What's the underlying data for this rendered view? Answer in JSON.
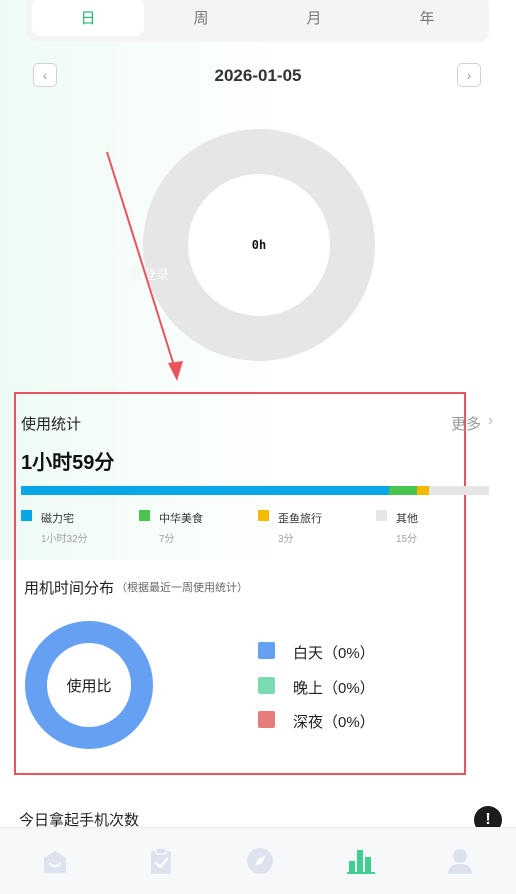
{
  "period_tabs": [
    {
      "label": "日",
      "active": true
    },
    {
      "label": "周",
      "active": false
    },
    {
      "label": "月",
      "active": false
    },
    {
      "label": "年",
      "active": false
    }
  ],
  "date_nav": {
    "date": "2026-01-05",
    "prev_icon": "chevron-left-icon",
    "next_icon": "chevron-right-icon"
  },
  "overview_ring": {
    "center_text": "0h",
    "overlay_text": "未登录",
    "ring_color": "#e6e6e6"
  },
  "usage_stats": {
    "title": "使用统计",
    "more_label": "更多",
    "total": "1小时59分",
    "apps": [
      {
        "name": "磁力宅",
        "duration": "1小时32分",
        "minutes": 92,
        "color": "#0aa7e8"
      },
      {
        "name": "中华美食",
        "duration": "7分",
        "minutes": 7,
        "color": "#49c24e"
      },
      {
        "name": "歪鱼旅行",
        "duration": "3分",
        "minutes": 3,
        "color": "#f6b900"
      },
      {
        "name": "其他",
        "duration": "15分",
        "minutes": 15,
        "color": "#e6e6e6"
      }
    ]
  },
  "time_distribution": {
    "title": "用机时间分布",
    "note": "（根据最近一周使用统计）",
    "pie_center": "使用比",
    "pie_color": "#66a0f2",
    "segments": [
      {
        "label": "白天（0%）",
        "share": 0,
        "color": "#66a0f2"
      },
      {
        "label": "晚上（0%）",
        "share": 0,
        "color": "#7ddbb4"
      },
      {
        "label": "深夜（0%）",
        "share": 0,
        "color": "#e67c7c"
      }
    ]
  },
  "pickups": {
    "title": "今日拿起手机次数",
    "info_icon": "exclamation-icon"
  },
  "bottom_nav": [
    {
      "icon": "home-icon",
      "active": false
    },
    {
      "icon": "clipboard-icon",
      "active": false
    },
    {
      "icon": "compass-icon",
      "active": false
    },
    {
      "icon": "bar-chart-icon",
      "active": true
    },
    {
      "icon": "profile-icon",
      "active": false
    }
  ],
  "colors": {
    "accent": "#26b46f",
    "highlight_frame": "#e9545c"
  }
}
